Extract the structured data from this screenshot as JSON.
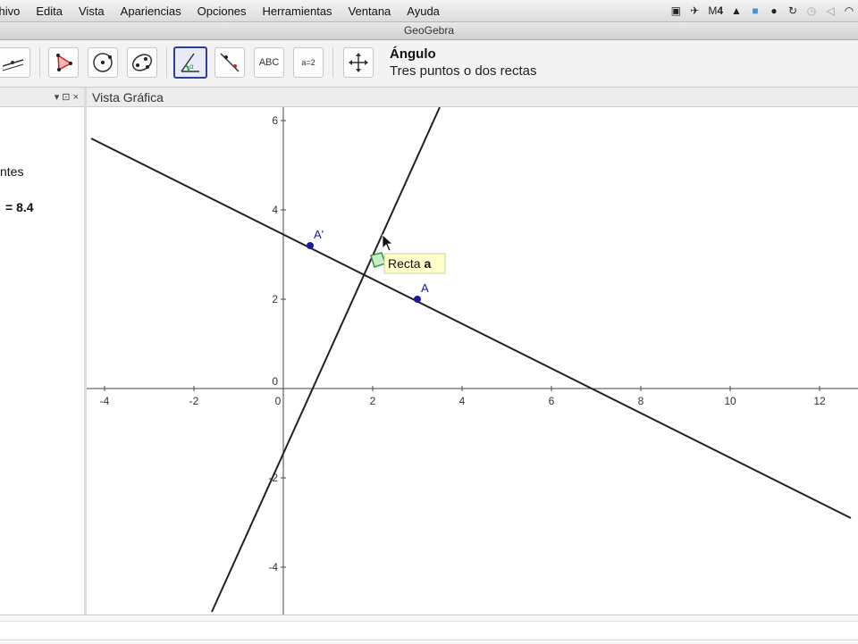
{
  "menubar": {
    "items": [
      "chivo",
      "Edita",
      "Vista",
      "Apariencias",
      "Opciones",
      "Herramientas",
      "Ventana",
      "Ayuda"
    ],
    "tray_battery_label": "4"
  },
  "window": {
    "title": "GeoGebra"
  },
  "toolbar": {
    "active_tool_name": "Ángulo",
    "active_tool_help": "Tres puntos o dos rectas",
    "text_tool_label": "ABC",
    "slider_tool_label": "a=2",
    "tools": [
      "segment-tool",
      "polygon-tool",
      "circle-center-tool",
      "conic-tool",
      "angle-tool",
      "reflect-tool",
      "text-tool",
      "slider-tool",
      "move-view-tool"
    ]
  },
  "algebra_view": {
    "header_controls": "▾ ⊡ ×",
    "items": [
      "ntes",
      "= 8.4"
    ]
  },
  "graphics_view": {
    "title": "Vista Gráfica",
    "x_ticks": [
      -4,
      -2,
      0,
      2,
      4,
      6,
      8,
      10,
      12
    ],
    "y_ticks": [
      -4,
      -2,
      0,
      2,
      4,
      6
    ],
    "points": [
      {
        "label": "A'",
        "x": 0.6,
        "y": 3.2,
        "color": "#1a1a9c"
      },
      {
        "label": "A",
        "x": 3.0,
        "y": 2.0,
        "color": "#1a1a9c"
      }
    ],
    "lines": [
      {
        "name": "a",
        "p1": [
          -4.3,
          5.6
        ],
        "p2": [
          12.7,
          -2.9
        ]
      },
      {
        "name": "b",
        "p1": [
          -1.6,
          -5
        ],
        "p2": [
          3.5,
          6.3
        ]
      }
    ],
    "tooltip_prefix": "Recta ",
    "tooltip_name": "a",
    "angle_marker_color": "#2e9c3a"
  }
}
